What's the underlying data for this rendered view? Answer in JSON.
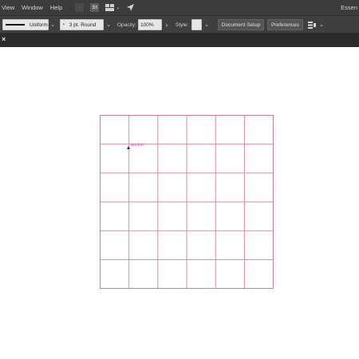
{
  "menubar": {
    "items": [
      "View",
      "Window",
      "Help"
    ],
    "workspace_label": "Essen",
    "icons": [
      "bridge-icon",
      "stock-icon",
      "arrange-documents-icon",
      "gpu-rocket-icon"
    ],
    "stock_label": "St"
  },
  "controlbar": {
    "stroke_profile": "Uniform",
    "brush": "3 pt. Round",
    "opacity_label": "Opacity:",
    "opacity_value": "100%",
    "style_label": "Style:",
    "document_setup": "Document Setup",
    "preferences": "Preferences",
    "chevron": "⌄",
    "arrow_right": "›"
  },
  "tabstrip": {
    "close_glyph": "×"
  },
  "canvas": {
    "grid_rows": 6,
    "grid_cols": 6,
    "cursor_tooltip": "anchor",
    "grid_color": "#d88ba3",
    "tooltip_color": "#d040c8"
  }
}
